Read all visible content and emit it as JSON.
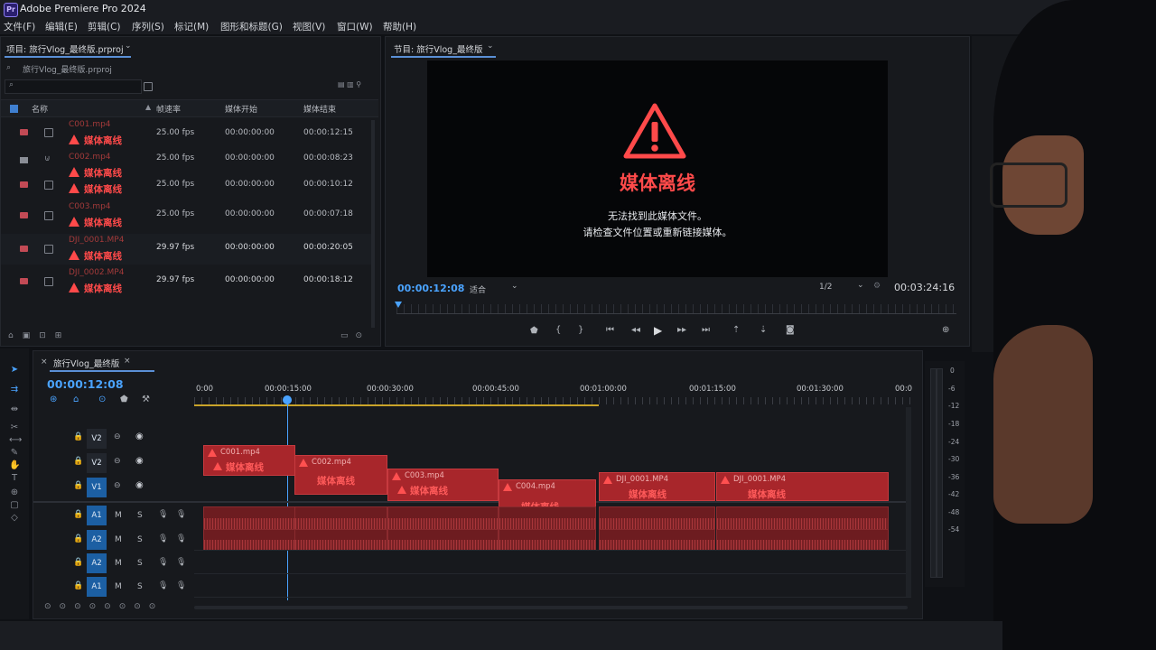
{
  "app": {
    "title": "Adobe Premiere Pro 2024",
    "logo": "Pr"
  },
  "menu": [
    "文件(F)",
    "编辑(E)",
    "剪辑(C)",
    "序列(S)",
    "标记(M)",
    "图形和标题(G)",
    "视图(V)",
    "窗口(W)",
    "帮助(H)"
  ],
  "project": {
    "tab": "项目: 旅行Vlog_最终版.prproj",
    "breadcrumb": "旅行Vlog_最终版.prproj",
    "search_placeholder": "",
    "columns": [
      "名称",
      "帧速率",
      "媒体开始",
      "媒体结束"
    ],
    "offline_label": "媒体离线",
    "items": [
      {
        "name": "C001.mp4",
        "offline_count": 1,
        "fps": "25.00 fps",
        "start": "00:00:00:00",
        "end": "00:00:12:15"
      },
      {
        "name": "C002.mp4",
        "offline_count": 2,
        "fps": "25.00 fps",
        "start": "00:00:00:00",
        "end": "00:00:08:23",
        "end2": "00:00:10:12",
        "fps2": "25.00 fps",
        "start2": "00:00:00:00"
      },
      {
        "name": "C003.mp4",
        "offline_count": 1,
        "fps": "25.00 fps",
        "start": "00:00:00:00",
        "end": "00:00:07:18"
      },
      {
        "name": "DJI_0001.MP4",
        "offline_count": 1,
        "fps": "29.97 fps",
        "start": "00:00:00:00",
        "end": "00:00:20:05"
      },
      {
        "name": "DJI_0002.MP4",
        "offline_count": 1,
        "fps": "29.97 fps",
        "start": "00:00:00:00",
        "end": "00:00:18:12"
      }
    ]
  },
  "program": {
    "tab": "节目: 旅行Vlog_最终版",
    "offline_title": "媒体离线",
    "offline_line1": "无法找到此媒体文件。",
    "offline_line2": "请检查文件位置或重新链接媒体。",
    "timecode": "00:00:12:08",
    "fit": "适合",
    "resolution": "1/2",
    "duration": "00:03:24:16"
  },
  "timeline": {
    "tab": "旅行Vlog_最终版",
    "timecode": "00:00:12:08",
    "ruler": [
      "0:00",
      "00:00:15:00",
      "00:00:30:00",
      "00:00:45:00",
      "00:01:00:00",
      "00:01:15:00",
      "00:01:30:00",
      "00:0"
    ],
    "video_tracks": [
      "V2",
      "V2",
      "V1"
    ],
    "audio_tracks": [
      {
        "label": "A1",
        "m": "M",
        "s": "S"
      },
      {
        "label": "A2",
        "m": "M",
        "s": "S"
      },
      {
        "label": "A2",
        "m": "M",
        "s": "S"
      },
      {
        "label": "A1",
        "m": "M",
        "s": "S"
      }
    ],
    "clips": [
      {
        "name": "C001.mp4",
        "label": "媒体离线"
      },
      {
        "name": "C002.mp4",
        "label": "媒体离线"
      },
      {
        "name": "C003.mp4",
        "label": "媒体离线"
      },
      {
        "name": "C004.mp4",
        "label": "媒体离线"
      },
      {
        "name": "DJI_0001.MP4",
        "label": "媒体离线"
      },
      {
        "name": "DJI_0001.MP4",
        "label": "媒体离线"
      }
    ]
  },
  "meter": {
    "labels": [
      "0",
      "-6",
      "-12",
      "-18",
      "-24",
      "-30",
      "-36",
      "-42",
      "-48",
      "-54"
    ]
  },
  "colors": {
    "accent": "#4aa3ff",
    "offline": "#ff4a4a",
    "clip": "#a8262b"
  }
}
